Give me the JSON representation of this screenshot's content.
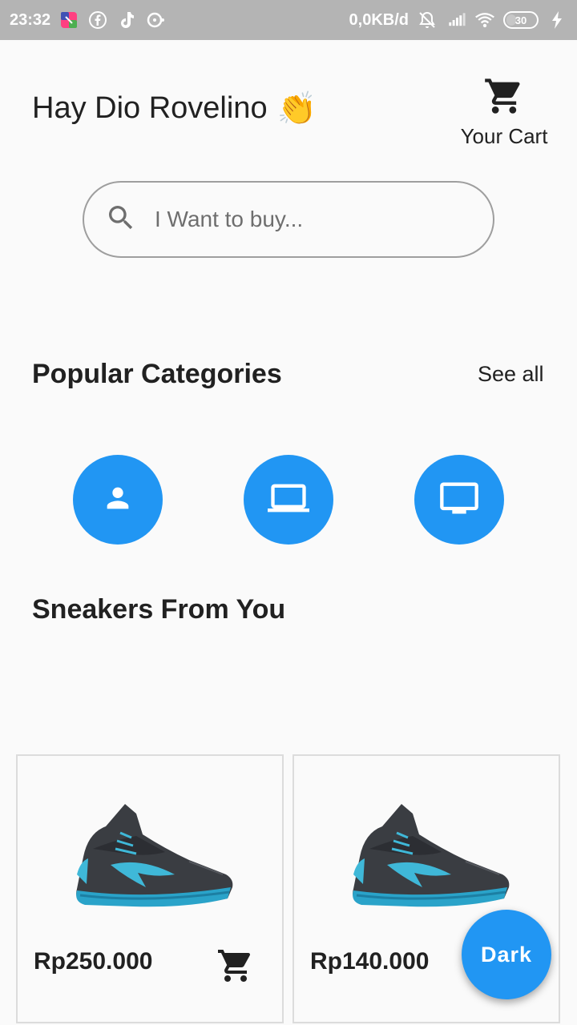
{
  "status_bar": {
    "time": "23:32",
    "network_speed": "0,0KB/d",
    "battery_level": "30",
    "icons": [
      "app-icon",
      "facebook-icon",
      "tiktok-icon",
      "chat-icon",
      "bell-off-icon",
      "signal-icon",
      "wifi-icon",
      "battery-icon",
      "charging-icon"
    ]
  },
  "header": {
    "greeting": "Hay Dio Rovelino",
    "greeting_emoji": "👏",
    "cart_label": "Your Cart",
    "cart_icon": "shopping-cart-icon"
  },
  "search": {
    "placeholder": "I Want to buy...",
    "value": "",
    "icon": "search-icon"
  },
  "categories": {
    "title": "Popular Categories",
    "see_all_label": "See all",
    "items": [
      {
        "icon": "person-icon"
      },
      {
        "icon": "laptop-icon"
      },
      {
        "icon": "monitor-icon"
      }
    ]
  },
  "products": {
    "title": "Sneakers From You",
    "items": [
      {
        "price": "Rp250.000",
        "image": "basketball-sneaker",
        "cart_icon": "add-to-cart-icon"
      },
      {
        "price": "Rp140.000",
        "image": "basketball-sneaker",
        "cart_icon": "add-to-cart-icon"
      }
    ]
  },
  "fab": {
    "label": "Dark"
  },
  "colors": {
    "accent": "#2196f3",
    "background": "#fafafa",
    "status_bar": "#b4b4b4",
    "text": "#212121"
  }
}
